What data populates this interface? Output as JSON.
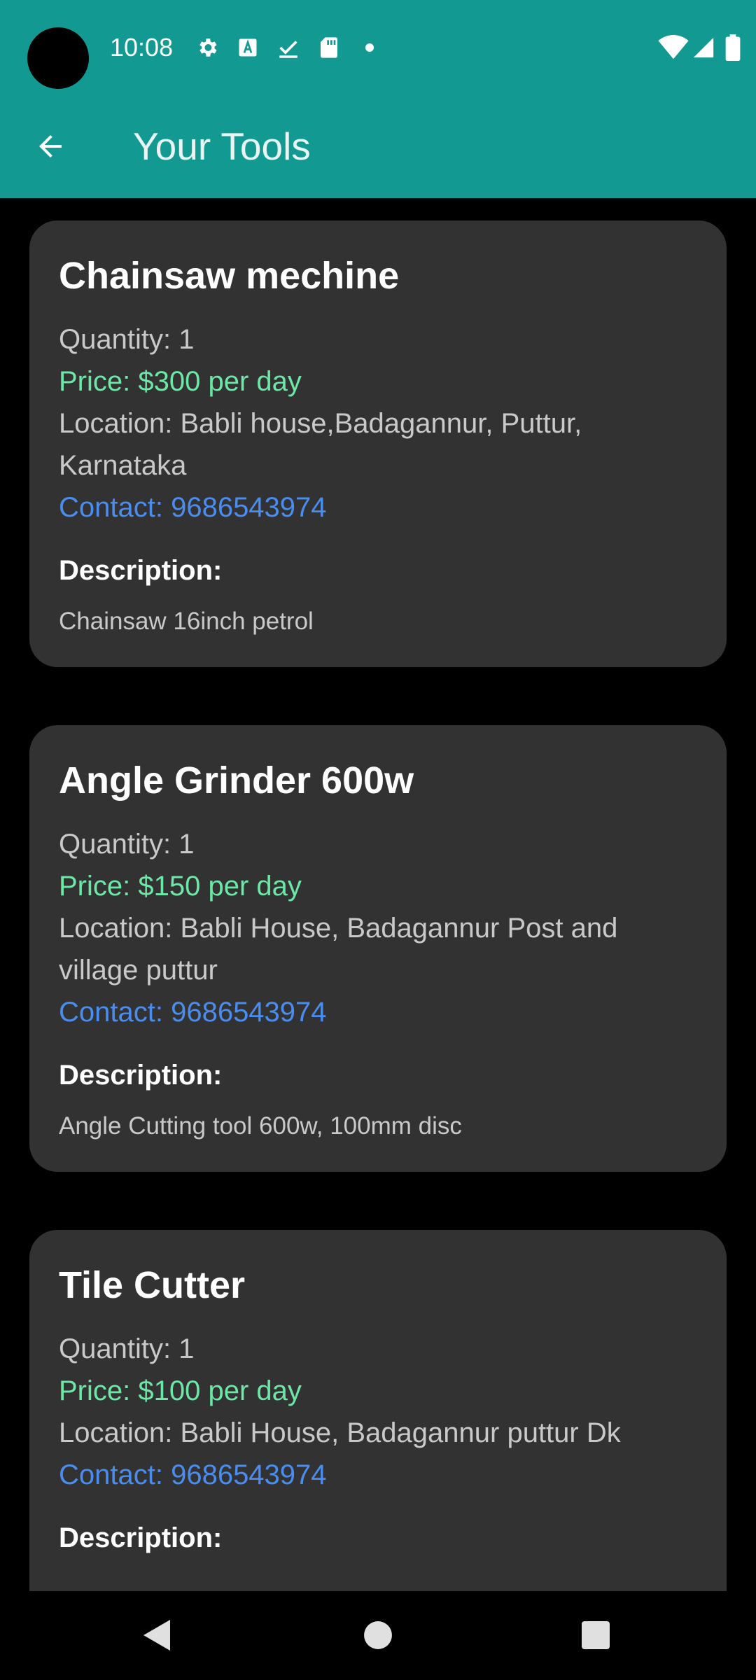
{
  "status_bar": {
    "time": "10:08",
    "left_icons": [
      "gear-icon",
      "text-a-icon",
      "download-done-icon",
      "sd-card-icon",
      "dot-icon"
    ],
    "right_icons": [
      "wifi-icon",
      "cell-signal-icon",
      "battery-icon"
    ]
  },
  "toolbar": {
    "title": "Your Tools",
    "back_icon": "arrow-back-icon",
    "background": "#129a92"
  },
  "tools": [
    {
      "name": "Chainsaw mechine",
      "quantity": "Quantity: 1",
      "price": "Price: $300 per day",
      "location": "Location: Babli house,Badagannur, Puttur, Karnataka",
      "contact": "Contact: 9686543974",
      "description_label": "Description:",
      "description": "Chainsaw 16inch petrol"
    },
    {
      "name": "Angle Grinder 600w",
      "quantity": "Quantity: 1",
      "price": "Price: $150 per day",
      "location": "Location: Babli House, Badagannur Post and village puttur",
      "contact": "Contact: 9686543974",
      "description_label": "Description:",
      "description": "Angle Cutting tool 600w, 100mm disc"
    },
    {
      "name": "Tile Cutter",
      "quantity": "Quantity: 1",
      "price": "Price: $100 per day",
      "location": "Location: Babli House, Badagannur puttur Dk",
      "contact": "Contact: 9686543974",
      "description_label": "Description:",
      "description": ""
    }
  ],
  "colors": {
    "card_background": "#323232",
    "price": "#6be8a6",
    "contact": "#4a8df0"
  },
  "nav_bar": {
    "icons": [
      "back-triangle-icon",
      "home-circle-icon",
      "recents-square-icon"
    ]
  }
}
